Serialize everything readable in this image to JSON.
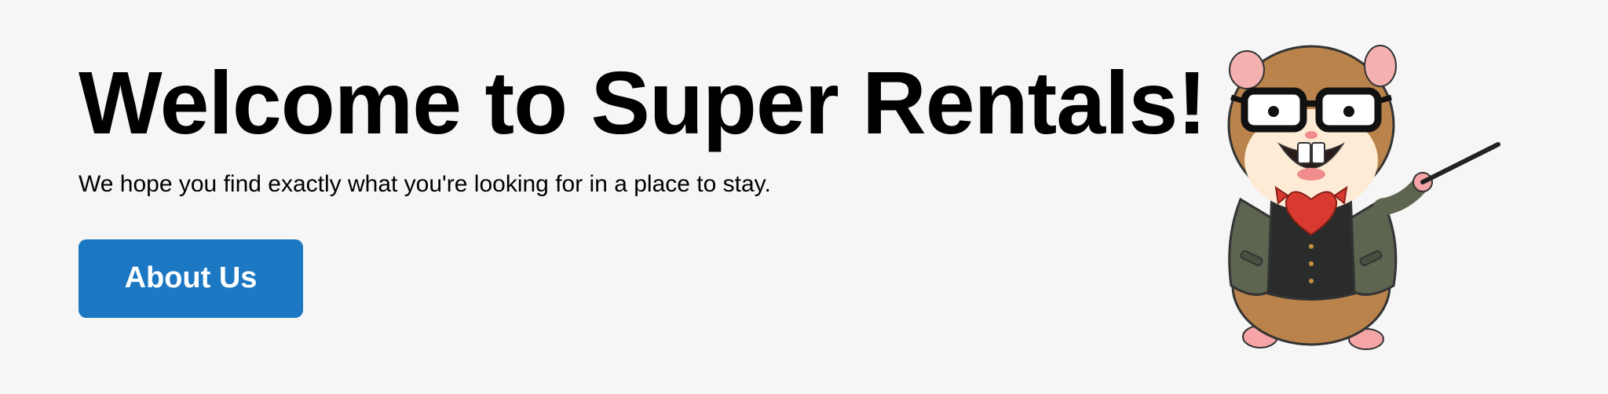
{
  "jumbo": {
    "title": "Welcome to Super Rentals!",
    "subtitle": "We hope you find exactly what you're looking for in a place to stay.",
    "about_button_label": "About Us"
  },
  "mascot": {
    "icon": "hamster-professor-icon"
  },
  "colors": {
    "background": "#f6f6f6",
    "button": "#1c78c3",
    "button_text": "#ffffff",
    "text": "#000000"
  }
}
